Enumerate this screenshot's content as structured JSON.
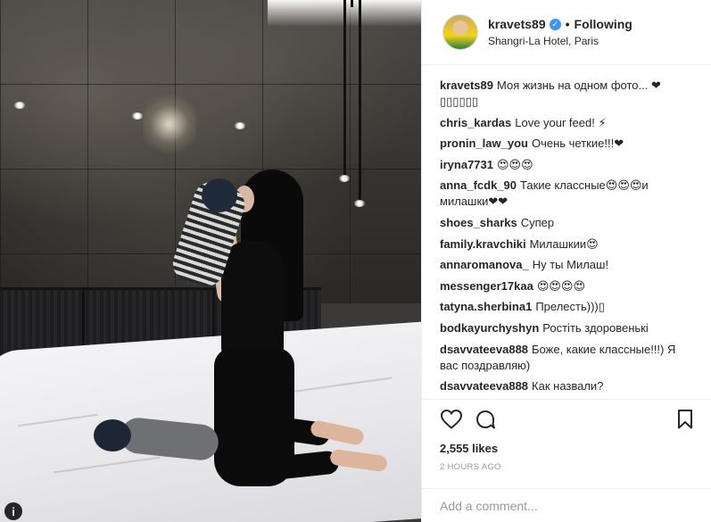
{
  "header": {
    "username": "kravets89",
    "verified_mark": "✓",
    "separator": "•",
    "follow_status": "Following",
    "location": "Shangri-La Hotel, Paris"
  },
  "comments": [
    {
      "user": "kravets89",
      "text": "Моя жизнь на одном фото... ❤ ▯▯▯▯▯▯"
    },
    {
      "user": "chris_kardas",
      "text": "Love your feed! ⚡"
    },
    {
      "user": "pronin_law_you",
      "text": "Очень четкие!!!❤"
    },
    {
      "user": "iryna7731",
      "text": "😍😍😍"
    },
    {
      "user": "anna_fcdk_90",
      "text": "Такие классные😍😍😍и милашки❤❤"
    },
    {
      "user": "shoes_sharks",
      "text": "Супер"
    },
    {
      "user": "family.kravchiki",
      "text": "Милашкии😍"
    },
    {
      "user": "annaromanova_",
      "text": "Ну ты Милаш!"
    },
    {
      "user": "messenger17kaa",
      "text": "😍😍😍😍"
    },
    {
      "user": "tatyna.sherbina1",
      "text": "Прелесть)))▯"
    },
    {
      "user": "bodkayurchyshyn",
      "text": "Ростіть здоровенькі"
    },
    {
      "user": "dsavvateeva888",
      "text": "Боже, какие классные!!!) Я вас поздравляю)"
    },
    {
      "user": "dsavvateeva888",
      "text": "Как назвали?"
    }
  ],
  "actions": {
    "like_icon": "heart-icon",
    "comment_icon": "comment-bubble-icon",
    "save_icon": "bookmark-icon"
  },
  "likes": "2,555 likes",
  "timestamp": "2 HOURS AGO",
  "add_comment": {
    "placeholder": "Add a comment..."
  },
  "photo": {
    "info_icon_glyph": "i"
  },
  "colors": {
    "accent_blue": "#3897f0",
    "text": "#262626",
    "muted": "#999999",
    "border": "#efefef"
  }
}
